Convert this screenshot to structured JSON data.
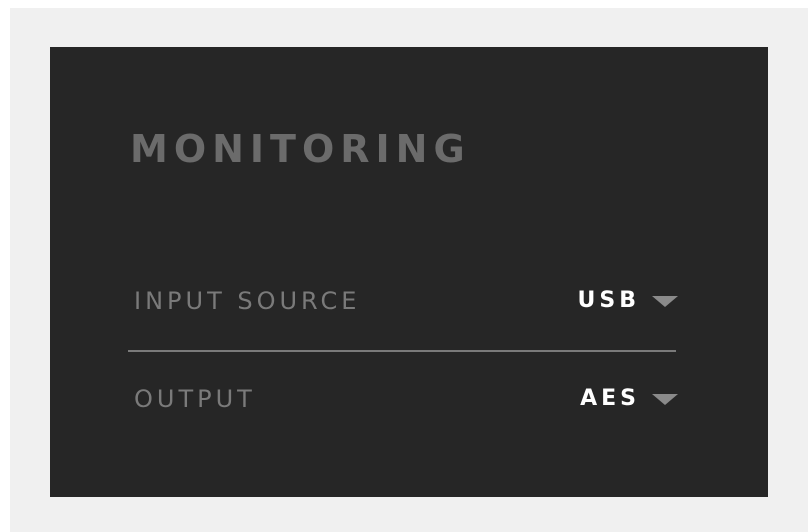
{
  "colors": {
    "outer_background": "#f0f0f0",
    "panel_background": "#262626",
    "title_color": "#6b6b6b",
    "label_color": "#7a7a7a",
    "value_color": "#ffffff",
    "caret_color": "#8a8a8a",
    "divider_color": "#7a7a7a"
  },
  "panel": {
    "title": "MONITORING",
    "rows": [
      {
        "label": "INPUT SOURCE",
        "value": "USB",
        "icon": "caret-down-icon"
      },
      {
        "label": "OUTPUT",
        "value": "AES",
        "icon": "caret-down-icon"
      }
    ]
  }
}
